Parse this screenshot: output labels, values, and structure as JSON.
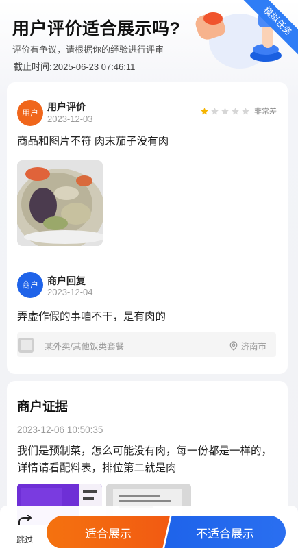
{
  "header": {
    "title": "用户评价适合展示吗?",
    "subtitle": "评价有争议，请根据你的经验进行评审",
    "deadline_label": "截止时间:",
    "deadline_value": "2025-06-23 07:46:11",
    "ribbon": "模拟任务"
  },
  "review": {
    "avatar_text": "用户",
    "name": "用户评价",
    "date": "2023-12-03",
    "rating": {
      "filled": 1,
      "total": 5,
      "label": "非常差"
    },
    "text": "商品和图片不符 肉末茄子没有肉"
  },
  "reply": {
    "avatar_text": "商户",
    "name": "商户回复",
    "date": "2023-12-04",
    "text": "弄虚作假的事咱不干，是有肉的"
  },
  "shop": {
    "name": "某外卖/其他饭类套餐",
    "location": "济南市"
  },
  "evidence": {
    "title": "商户证据",
    "time": "2023-12-06 10:50:35",
    "text": "我们是预制菜，怎么可能没有肉，每一份都是一样的，详情请看配料表，排位第二就是肉"
  },
  "actions": {
    "skip": "跳过",
    "suitable": "适合展示",
    "unsuitable": "不适合展示"
  },
  "colors": {
    "orange": "#f0661b",
    "blue": "#1f63e9",
    "star_filled": "#f5b400",
    "star_empty": "#d6d6d6"
  }
}
